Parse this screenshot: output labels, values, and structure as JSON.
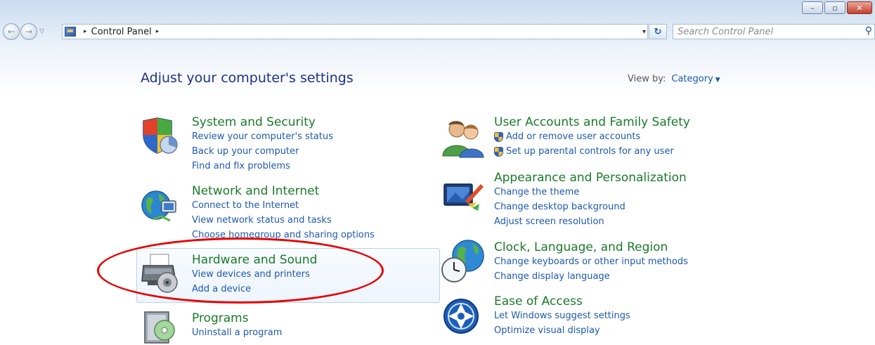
{
  "window": {
    "minimize_glyph": "–",
    "maximize_glyph": "▫",
    "close_glyph": "✕"
  },
  "toolbar": {
    "back_glyph": "←",
    "forward_glyph": "→",
    "history_glyph": "▽",
    "breadcrumb": [
      "Control Panel"
    ],
    "crumb_arrow": "▸",
    "address_dropdown_glyph": "▾",
    "refresh_glyph": "↻",
    "search_placeholder": "Search Control Panel",
    "search_glyph": "⚲"
  },
  "main": {
    "heading": "Adjust your computer's settings",
    "view_by_label": "View by:",
    "view_by_value": "Category",
    "view_by_glyph": "▼"
  },
  "categories": {
    "system_security": {
      "title": "System and Security",
      "links": [
        "Review your computer's status",
        "Back up your computer",
        "Find and fix problems"
      ]
    },
    "network_internet": {
      "title": "Network and Internet",
      "links": [
        "Connect to the Internet",
        "View network status and tasks",
        "Choose homegroup and sharing options"
      ]
    },
    "hardware_sound": {
      "title": "Hardware and Sound",
      "links": [
        "View devices and printers",
        "Add a device"
      ]
    },
    "programs": {
      "title": "Programs",
      "links": [
        "Uninstall a program"
      ]
    },
    "user_accounts": {
      "title": "User Accounts and Family Safety",
      "links": [
        "Add or remove user accounts",
        "Set up parental controls for any user"
      ]
    },
    "appearance": {
      "title": "Appearance and Personalization",
      "links": [
        "Change the theme",
        "Change desktop background",
        "Adjust screen resolution"
      ]
    },
    "clock_region": {
      "title": "Clock, Language, and Region",
      "links": [
        "Change keyboards or other input methods",
        "Change display language"
      ]
    },
    "ease_access": {
      "title": "Ease of Access",
      "links": [
        "Let Windows suggest settings",
        "Optimize visual display"
      ]
    }
  },
  "annotation": {
    "color": "#e60000"
  }
}
